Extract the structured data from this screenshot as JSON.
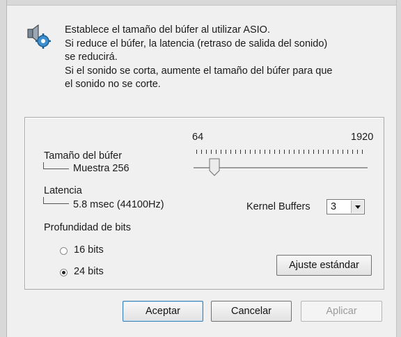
{
  "description": {
    "lines": [
      "Establece el tamaño del búfer al utilizar ASIO.",
      "Si reduce el búfer, la latencia (retraso de salida del sonido)",
      "se reducirá.",
      "Si el sonido se corta, aumente el tamaño del búfer para que",
      "el sonido no se corte."
    ],
    "icon": "speaker-settings-icon"
  },
  "buffer": {
    "label": "Tamaño del búfer",
    "value": "Muestra 256",
    "slider_min": "64",
    "slider_max": "1920",
    "slider_value": 256
  },
  "latency": {
    "label": "Latencia",
    "value": "5.8 msec (44100Hz)"
  },
  "kernel_buffers": {
    "label": "Kernel Buffers",
    "value": "3"
  },
  "bit_depth": {
    "label": "Profundidad de bits",
    "options": [
      {
        "label": "16 bits",
        "selected": false
      },
      {
        "label": "24 bits",
        "selected": true
      }
    ]
  },
  "buttons": {
    "default": "Ajuste estándar",
    "ok": "Aceptar",
    "cancel": "Cancelar",
    "apply": "Aplicar"
  }
}
